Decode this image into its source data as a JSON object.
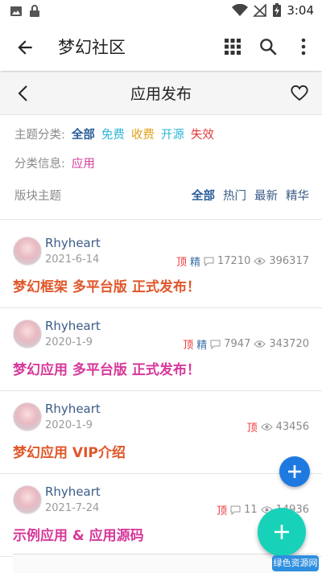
{
  "status": {
    "time": "3:04"
  },
  "appbar": {
    "title": "梦幻社区"
  },
  "subbar": {
    "title": "应用发布"
  },
  "filters": {
    "theme_label": "主题分类:",
    "theme_options": [
      {
        "label": "全部",
        "color": "#2a5d9a",
        "bold": true
      },
      {
        "label": "免费",
        "color": "#2fb5d8"
      },
      {
        "label": "收费",
        "color": "#e0a11a"
      },
      {
        "label": "开源",
        "color": "#2fb5d8"
      },
      {
        "label": "失效",
        "color": "#e03a3a"
      }
    ],
    "info_label": "分类信息:",
    "info_value": "应用",
    "info_color": "#d6389a"
  },
  "sort": {
    "label": "版块主题",
    "tabs": [
      {
        "label": "全部",
        "active": true
      },
      {
        "label": "热门"
      },
      {
        "label": "最新"
      },
      {
        "label": "精华"
      }
    ]
  },
  "posts": [
    {
      "author": "Rhyheart",
      "date": "2021-6-14",
      "top": "顶",
      "jing": "精",
      "comments": "17210",
      "views": "396317",
      "title": "梦幻框架 多平台版 正式发布！",
      "title_color": "#e0572a"
    },
    {
      "author": "Rhyheart",
      "date": "2020-1-9",
      "top": "顶",
      "jing": "精",
      "comments": "7947",
      "views": "343720",
      "title": "梦幻应用 多平台版 正式发布！",
      "title_color": "#d6389a"
    },
    {
      "author": "Rhyheart",
      "date": "2020-1-9",
      "top": "顶",
      "jing": "",
      "comments": "",
      "views": "43456",
      "title": "梦幻应用 VIP介绍",
      "title_color": "#e0572a"
    },
    {
      "author": "Rhyheart",
      "date": "2021-7-24",
      "top": "顶",
      "jing": "",
      "comments": "11",
      "views": "14936",
      "title": "示例应用 & 应用源码",
      "title_color": "#d6389a"
    }
  ],
  "watermark": "绿色资源网"
}
